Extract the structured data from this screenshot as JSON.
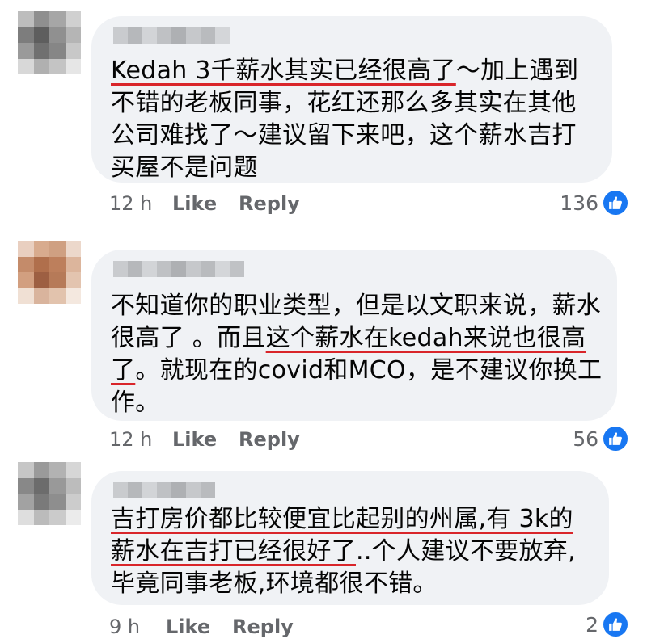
{
  "comments": [
    {
      "segments": [
        {
          "text": "Kedah 3千薪水其实已经很高了",
          "underline": true
        },
        {
          "text": "～加上遇到不错的老板同事，花红还那么多其实在其他公司难找了～建议留下来吧，这个薪水吉打买屋不是问题",
          "underline": false
        }
      ],
      "time": "12 h",
      "like_label": "Like",
      "reply_label": "Reply",
      "reaction_count": "136",
      "reaction_icon": "thumbs-up-icon"
    },
    {
      "segments": [
        {
          "text": "不知道你的职业类型，但是以文职来说，薪水很高了 。而且",
          "underline": false
        },
        {
          "text": "这个薪水在kedah来说也很高了",
          "underline": true
        },
        {
          "text": "。就现在的covid和MCO，是不建议你换工作。",
          "underline": false
        }
      ],
      "time": "12 h",
      "like_label": "Like",
      "reply_label": "Reply",
      "reaction_count": "56",
      "reaction_icon": "thumbs-up-icon"
    },
    {
      "segments": [
        {
          "text": "吉打房价都比较便宜比起别的州属,有 3k的薪水在吉打已经很好了",
          "underline": true
        },
        {
          "text": "..个人建议不要放弃,毕竟同事老板,环境都很不错。",
          "underline": false
        }
      ],
      "time": "9 h",
      "like_label": "Like",
      "reply_label": "Reply",
      "reaction_count": "2",
      "reaction_icon": "thumbs-up-icon"
    }
  ],
  "colors": {
    "bubble": "#f0f2f5",
    "underline": "#d9252a",
    "meta_text": "#65676b",
    "like_blue": "#1877f2"
  }
}
